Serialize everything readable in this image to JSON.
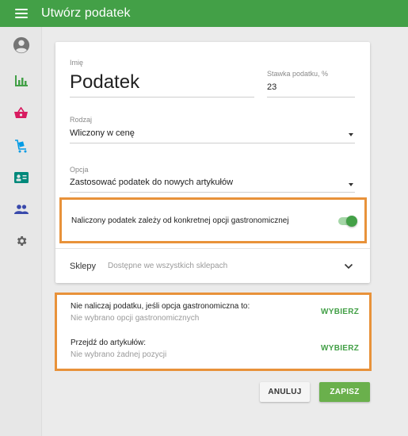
{
  "app": {
    "title": "Utwórz podatek",
    "accent_color": "#43a047",
    "highlight_color": "#e8923a"
  },
  "sidebar": {
    "items": [
      {
        "icon": "account-circle-icon",
        "color": "#757575"
      },
      {
        "icon": "bar-chart-icon",
        "color": "#43a047"
      },
      {
        "icon": "basket-icon",
        "color": "#d81b60"
      },
      {
        "icon": "cart-icon",
        "color": "#039be5"
      },
      {
        "icon": "employee-card-icon",
        "color": "#00897b"
      },
      {
        "icon": "people-icon",
        "color": "#3949ab"
      },
      {
        "icon": "gear-icon",
        "color": "#616161"
      }
    ]
  },
  "form": {
    "name_label": "Imię",
    "name_value": "Podatek",
    "rate_label": "Stawka podatku, %",
    "rate_value": "23",
    "type_label": "Rodzaj",
    "type_value": "Wliczony w cenę",
    "option_label": "Opcja",
    "option_value": "Zastosować podatek do nowych artykułów",
    "toggle_label": "Naliczony podatek zależy od konkretnej opcji gastronomicznej",
    "toggle_on": true,
    "stores_label": "Sklepy",
    "stores_value": "Dostępne we wszystkich sklepach"
  },
  "options": {
    "dining": {
      "title": "Nie naliczaj podatku, jeśli opcja gastronomiczna to:",
      "subtitle": "Nie wybrano opcji gastronomicznych",
      "action": "WYBIERZ"
    },
    "items": {
      "title": "Przejdź do artykułów:",
      "subtitle": "Nie wybrano żadnej pozycji",
      "action": "WYBIERZ"
    }
  },
  "buttons": {
    "cancel": "ANULUJ",
    "save": "ZAPISZ"
  }
}
